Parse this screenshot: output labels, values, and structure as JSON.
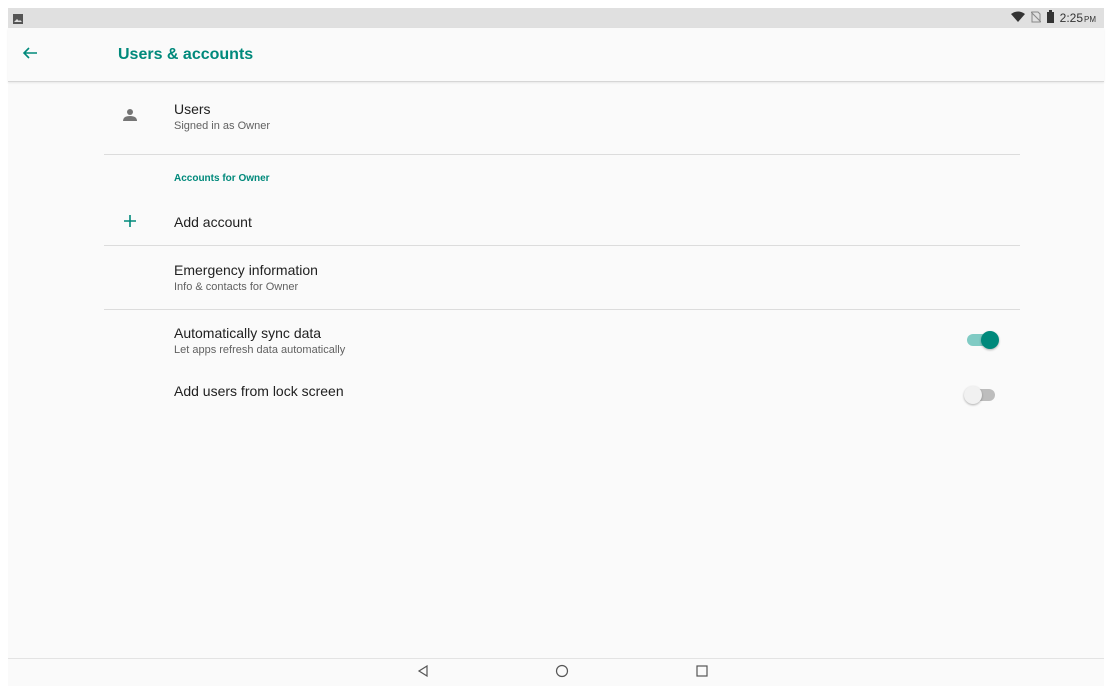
{
  "status_bar": {
    "time": "2:25",
    "ampm": "PM",
    "icons": [
      "image-icon",
      "wifi-icon",
      "no-sim-icon",
      "battery-icon"
    ]
  },
  "app_bar": {
    "title": "Users & accounts",
    "back_icon": "arrow-back-icon"
  },
  "rows": {
    "users": {
      "title": "Users",
      "subtitle": "Signed in as Owner",
      "icon": "person-icon"
    },
    "accounts_header": "Accounts for Owner",
    "add_account": {
      "title": "Add account",
      "icon": "plus-icon"
    },
    "emergency": {
      "title": "Emergency information",
      "subtitle": "Info & contacts for Owner"
    },
    "auto_sync": {
      "title": "Automatically sync data",
      "subtitle": "Let apps refresh data automatically",
      "enabled": true
    },
    "add_users_lock": {
      "title": "Add users from lock screen",
      "enabled": false
    }
  },
  "nav_bar": {
    "buttons": [
      "back-triangle-icon",
      "home-circle-icon",
      "recents-square-icon"
    ]
  },
  "colors": {
    "accent": "#00897b",
    "accent_light": "#80cbc4",
    "text_primary": "#212121",
    "text_secondary": "#616161"
  }
}
